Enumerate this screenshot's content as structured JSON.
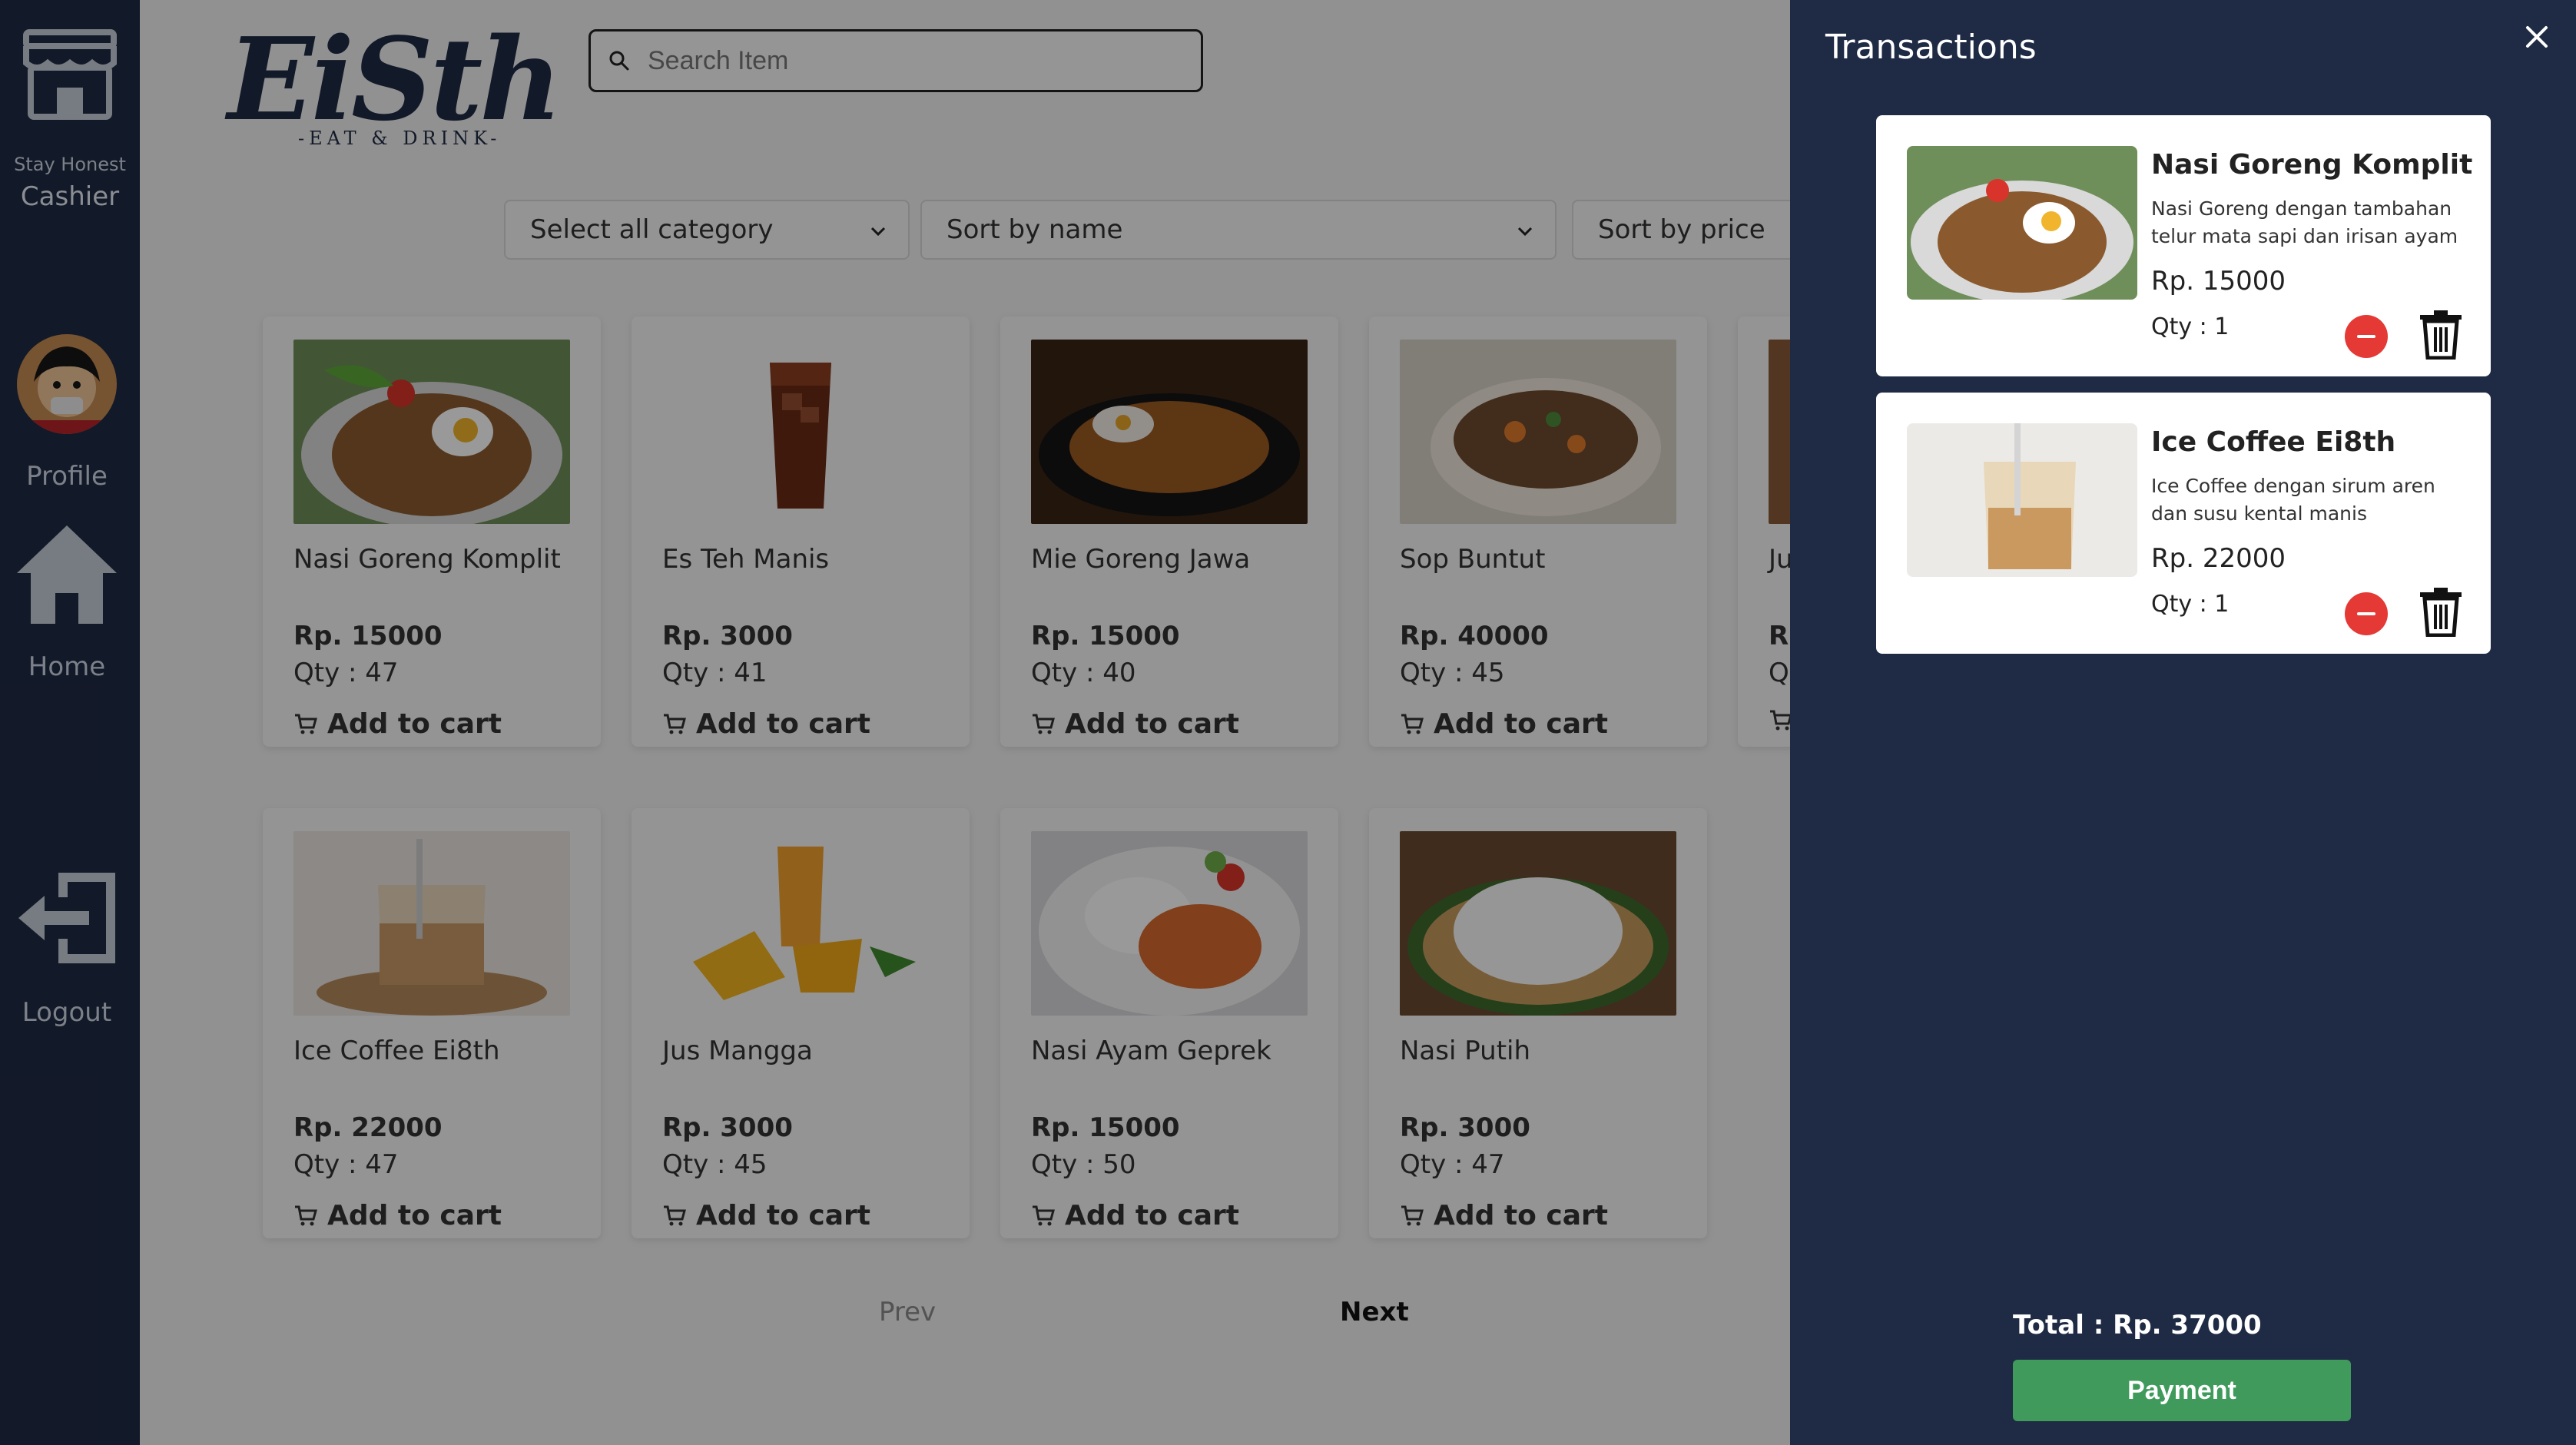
{
  "sidebar": {
    "store_icon": "store-icon",
    "tagline": "Stay Honest",
    "role": "Cashier",
    "profile_label": "Profile",
    "home_label": "Home",
    "logout_label": "Logout"
  },
  "brand": {
    "name": "EiSth",
    "sub": "-EAT & DRINK-"
  },
  "search": {
    "placeholder": "Search Item",
    "value": ""
  },
  "filters": {
    "category": "Select all category",
    "sort_name": "Sort by name",
    "sort_price": "Sort by price"
  },
  "products": [
    {
      "name": "Nasi Goreng Komplit",
      "price": "Rp. 15000",
      "qty": "Qty : 47",
      "add": "Add to cart"
    },
    {
      "name": "Es Teh Manis",
      "price": "Rp. 3000",
      "qty": "Qty : 41",
      "add": "Add to cart"
    },
    {
      "name": "Mie Goreng Jawa",
      "price": "Rp. 15000",
      "qty": "Qty : 40",
      "add": "Add to cart"
    },
    {
      "name": "Sop Buntut",
      "price": "Rp. 40000",
      "qty": "Qty : 45",
      "add": "Add to cart"
    },
    {
      "name": "Ju",
      "price": "R",
      "qty": "Q",
      "add": ""
    },
    {
      "name": "Ice Coffee Ei8th",
      "price": "Rp. 22000",
      "qty": "Qty : 47",
      "add": "Add to cart"
    },
    {
      "name": "Jus Mangga",
      "price": "Rp. 3000",
      "qty": "Qty : 45",
      "add": "Add to cart"
    },
    {
      "name": "Nasi Ayam Geprek",
      "price": "Rp. 15000",
      "qty": "Qty : 50",
      "add": "Add to cart"
    },
    {
      "name": "Nasi Putih",
      "price": "Rp. 3000",
      "qty": "Qty : 47",
      "add": "Add to cart"
    }
  ],
  "pagination": {
    "prev": "Prev",
    "next": "Next"
  },
  "transactions": {
    "title": "Transactions",
    "items": [
      {
        "name": "Nasi Goreng Komplit",
        "desc": "Nasi Goreng dengan tambahan telur mata sapi dan irisan ayam",
        "price": "Rp. 15000",
        "qty": "Qty : 1"
      },
      {
        "name": "Ice Coffee Ei8th",
        "desc": "Ice Coffee dengan sirum aren dan susu kental manis",
        "price": "Rp. 22000",
        "qty": "Qty : 1"
      }
    ],
    "total": "Total : Rp. 37000",
    "payment": "Payment"
  },
  "colors": {
    "sidebar": "#1f2a44",
    "pay_button": "#3f9a5c",
    "remove_button": "#e53935"
  }
}
